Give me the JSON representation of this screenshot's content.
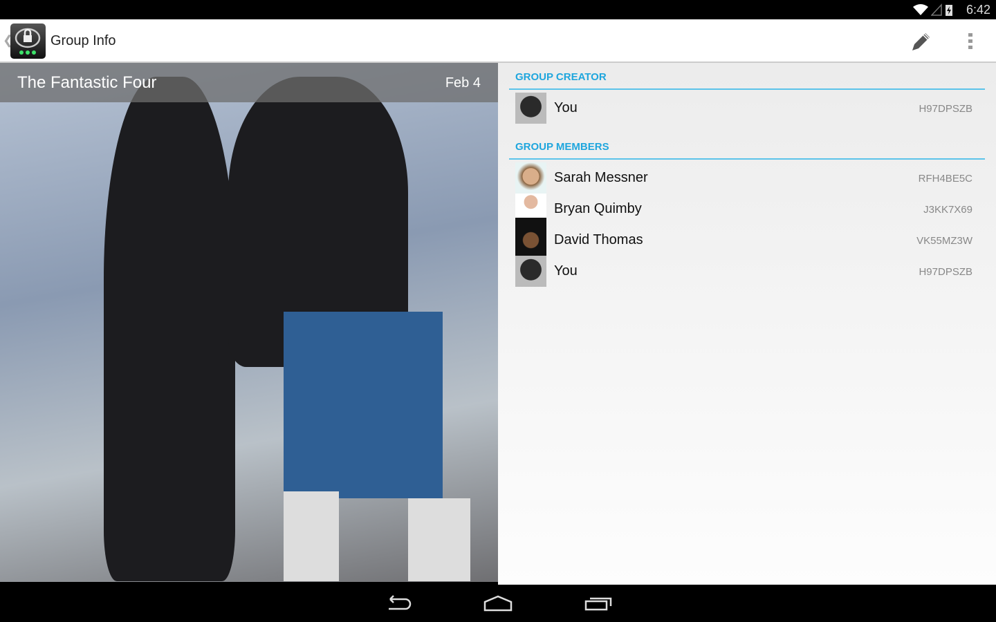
{
  "status": {
    "time": "6:42",
    "icons": [
      "wifi-icon",
      "signal-icon",
      "battery-charging-icon"
    ]
  },
  "actionbar": {
    "title": "Group Info",
    "actions": [
      "edit-icon",
      "overflow-menu-icon"
    ]
  },
  "group": {
    "name": "The Fantastic Four",
    "date": "Feb 4"
  },
  "creator": {
    "header": "GROUP CREATOR",
    "member": {
      "name": "You",
      "id": "H97DPSZB",
      "avatar_color": "#2a2a2a"
    }
  },
  "members": {
    "header": "GROUP MEMBERS",
    "list": [
      {
        "name": "Sarah Messner",
        "id": "RFH4BE5C",
        "avatar_color": "#c89a70"
      },
      {
        "name": "Bryan Quimby",
        "id": "J3KK7X69",
        "avatar_color": "#d8b8a0"
      },
      {
        "name": "David Thomas",
        "id": "VK55MZ3W",
        "avatar_color": "#6b4a2e"
      },
      {
        "name": "You",
        "id": "H97DPSZB",
        "avatar_color": "#2a2a2a"
      }
    ]
  },
  "colors": {
    "accent": "#1fa6dd",
    "divider": "#5bc3ea"
  }
}
